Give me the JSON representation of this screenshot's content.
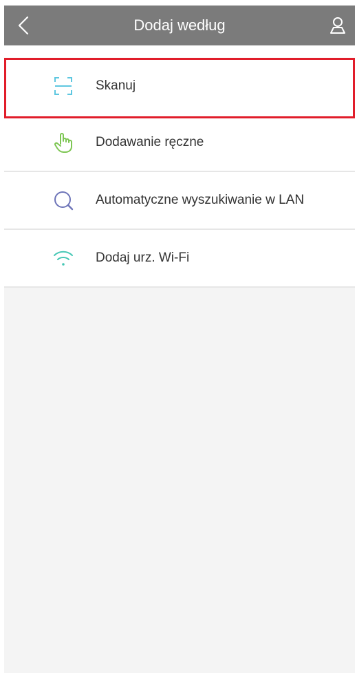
{
  "header": {
    "title": "Dodaj według",
    "back_icon": "chevron-left-icon",
    "user_icon": "user-icon"
  },
  "menu": {
    "items": [
      {
        "label": "Skanuj",
        "icon": "scan-icon",
        "icon_color": "#5ec7e0"
      },
      {
        "label": "Dodawanie ręczne",
        "icon": "hand-pointer-icon",
        "icon_color": "#7dc653"
      },
      {
        "label": "Automatyczne wyszukiwanie w LAN",
        "icon": "search-icon",
        "icon_color": "#6d74b8"
      },
      {
        "label": "Dodaj urz. Wi-Fi",
        "icon": "wifi-icon",
        "icon_color": "#45c7b5"
      }
    ]
  },
  "colors": {
    "header_bg": "#7b7b7b",
    "highlight_border": "#e11d2a",
    "page_bg": "#f4f4f4"
  }
}
